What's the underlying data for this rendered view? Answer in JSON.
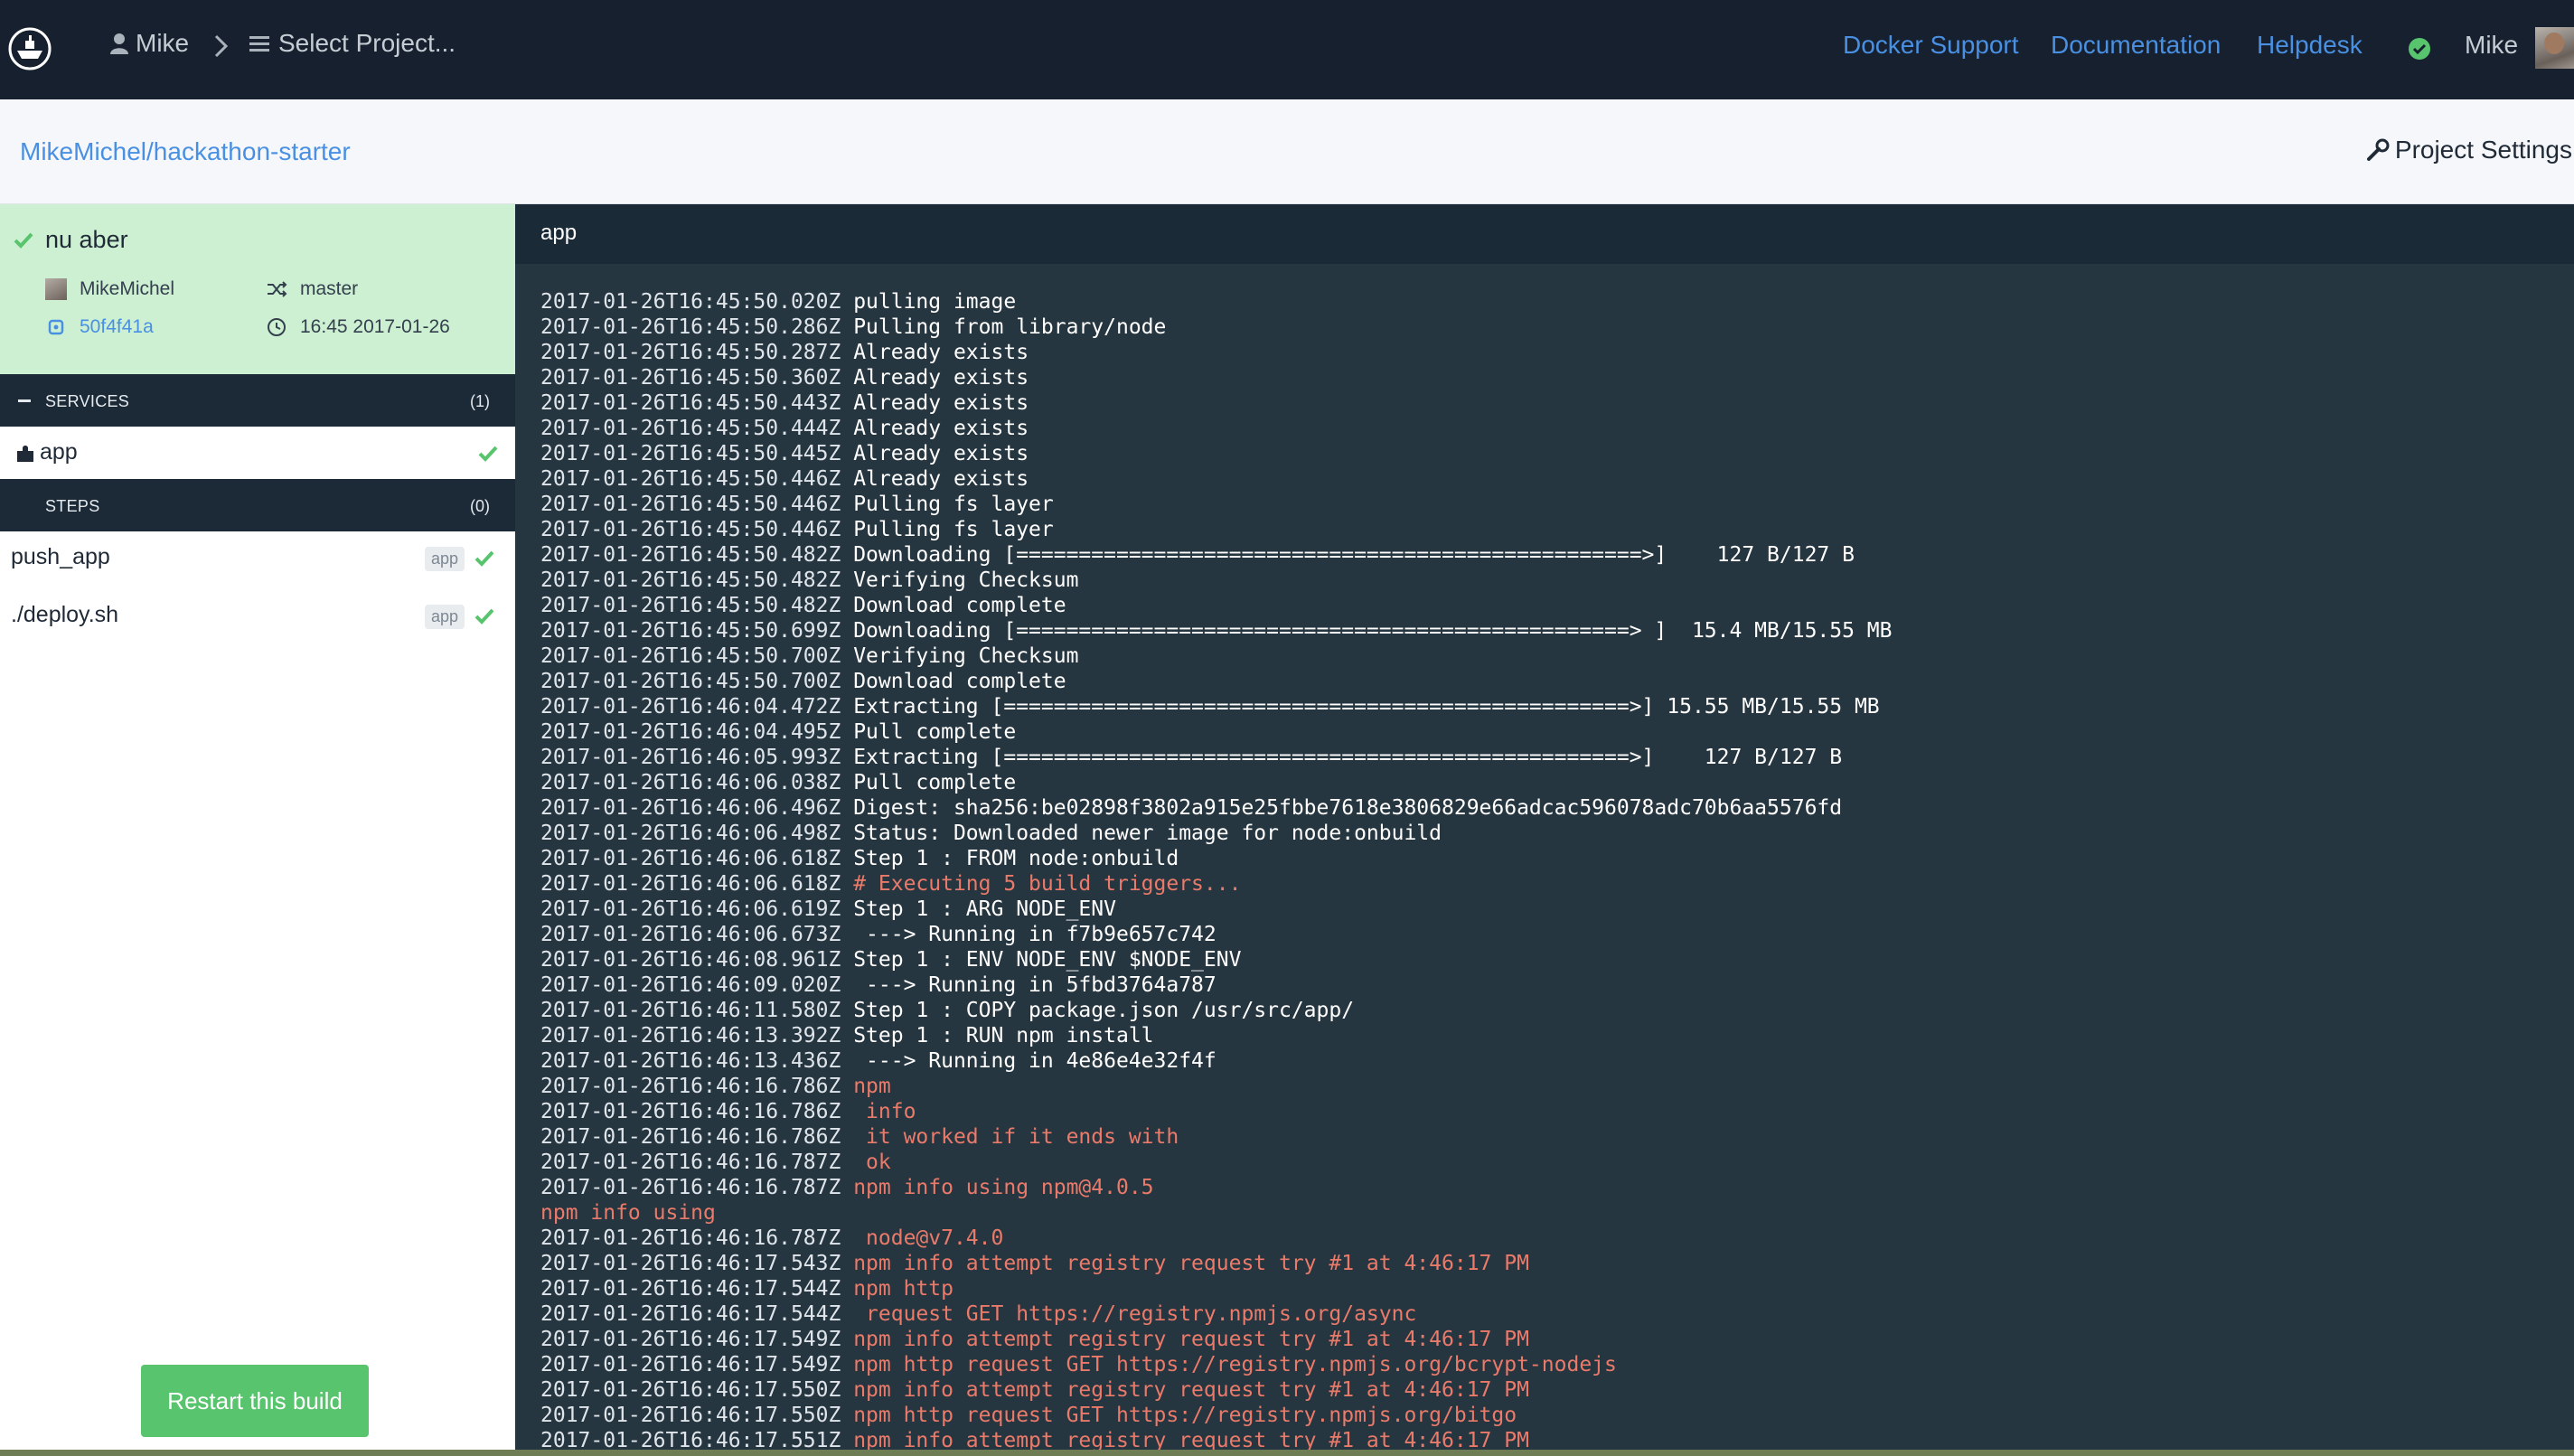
{
  "topbar": {
    "user": "Mike",
    "project_select": "Select Project...",
    "links": [
      "Docker Support",
      "Documentation",
      "Helpdesk"
    ],
    "account_name": "Mike"
  },
  "subheader": {
    "repo": "MikeMichel/hackathon-starter",
    "settings_label": "Project Settings"
  },
  "build": {
    "title": "nu aber",
    "author": "MikeMichel",
    "branch": "master",
    "commit": "50f4f41a",
    "time": "16:45 2017-01-26"
  },
  "services": {
    "label": "SERVICES",
    "count": "(1)",
    "items": [
      {
        "name": "app"
      }
    ]
  },
  "steps": {
    "label": "STEPS",
    "count": "(0)",
    "items": [
      {
        "name": "push_app",
        "tag": "app"
      },
      {
        "name": "./deploy.sh",
        "tag": "app"
      }
    ]
  },
  "restart_label": "Restart this build",
  "log": {
    "title": "app",
    "lines": [
      {
        "ts": "2017-01-26T16:45:50.020Z",
        "msg": "pulling image",
        "err": false
      },
      {
        "ts": "2017-01-26T16:45:50.286Z",
        "msg": "Pulling from library/node",
        "err": false
      },
      {
        "ts": "2017-01-26T16:45:50.287Z",
        "msg": "Already exists",
        "err": false
      },
      {
        "ts": "2017-01-26T16:45:50.360Z",
        "msg": "Already exists",
        "err": false
      },
      {
        "ts": "2017-01-26T16:45:50.443Z",
        "msg": "Already exists",
        "err": false
      },
      {
        "ts": "2017-01-26T16:45:50.444Z",
        "msg": "Already exists",
        "err": false
      },
      {
        "ts": "2017-01-26T16:45:50.445Z",
        "msg": "Already exists",
        "err": false
      },
      {
        "ts": "2017-01-26T16:45:50.446Z",
        "msg": "Already exists",
        "err": false
      },
      {
        "ts": "2017-01-26T16:45:50.446Z",
        "msg": "Pulling fs layer",
        "err": false
      },
      {
        "ts": "2017-01-26T16:45:50.446Z",
        "msg": "Pulling fs layer",
        "err": false
      },
      {
        "ts": "2017-01-26T16:45:50.482Z",
        "msg": "Downloading [==================================================>]    127 B/127 B",
        "err": false
      },
      {
        "ts": "2017-01-26T16:45:50.482Z",
        "msg": "Verifying Checksum",
        "err": false
      },
      {
        "ts": "2017-01-26T16:45:50.482Z",
        "msg": "Download complete",
        "err": false
      },
      {
        "ts": "2017-01-26T16:45:50.699Z",
        "msg": "Downloading [=================================================> ]  15.4 MB/15.55 MB",
        "err": false
      },
      {
        "ts": "2017-01-26T16:45:50.700Z",
        "msg": "Verifying Checksum",
        "err": false
      },
      {
        "ts": "2017-01-26T16:45:50.700Z",
        "msg": "Download complete",
        "err": false
      },
      {
        "ts": "2017-01-26T16:46:04.472Z",
        "msg": "Extracting [==================================================>] 15.55 MB/15.55 MB",
        "err": false
      },
      {
        "ts": "2017-01-26T16:46:04.495Z",
        "msg": "Pull complete",
        "err": false
      },
      {
        "ts": "2017-01-26T16:46:05.993Z",
        "msg": "Extracting [==================================================>]    127 B/127 B",
        "err": false
      },
      {
        "ts": "2017-01-26T16:46:06.038Z",
        "msg": "Pull complete",
        "err": false
      },
      {
        "ts": "2017-01-26T16:46:06.496Z",
        "msg": "Digest: sha256:be02898f3802a915e25fbbe7618e3806829e66adcac596078adc70b6aa5576fd",
        "err": false
      },
      {
        "ts": "2017-01-26T16:46:06.498Z",
        "msg": "Status: Downloaded newer image for node:onbuild",
        "err": false
      },
      {
        "ts": "2017-01-26T16:46:06.618Z",
        "msg": "Step 1 : FROM node:onbuild",
        "err": false
      },
      {
        "ts": "2017-01-26T16:46:06.618Z",
        "msg": "# Executing 5 build triggers...",
        "err": true
      },
      {
        "ts": "2017-01-26T16:46:06.619Z",
        "msg": "Step 1 : ARG NODE_ENV",
        "err": false
      },
      {
        "ts": "2017-01-26T16:46:06.673Z",
        "msg": " ---> Running in f7b9e657c742",
        "err": false
      },
      {
        "ts": "2017-01-26T16:46:08.961Z",
        "msg": "Step 1 : ENV NODE_ENV $NODE_ENV",
        "err": false
      },
      {
        "ts": "2017-01-26T16:46:09.020Z",
        "msg": " ---> Running in 5fbd3764a787",
        "err": false
      },
      {
        "ts": "2017-01-26T16:46:11.580Z",
        "msg": "Step 1 : COPY package.json /usr/src/app/",
        "err": false
      },
      {
        "ts": "2017-01-26T16:46:13.392Z",
        "msg": "Step 1 : RUN npm install",
        "err": false
      },
      {
        "ts": "2017-01-26T16:46:13.436Z",
        "msg": " ---> Running in 4e86e4e32f4f",
        "err": false
      },
      {
        "ts": "2017-01-26T16:46:16.786Z",
        "msg": "npm",
        "err": true
      },
      {
        "ts": "2017-01-26T16:46:16.786Z",
        "msg": " info",
        "err": true
      },
      {
        "ts": "2017-01-26T16:46:16.786Z",
        "msg": " it worked if it ends with",
        "err": true
      },
      {
        "ts": "2017-01-26T16:46:16.787Z",
        "msg": " ok",
        "err": true
      },
      {
        "ts": "2017-01-26T16:46:16.787Z",
        "msg": "npm info using npm@4.0.5",
        "err": true
      },
      {
        "ts": "",
        "msg": "npm info using",
        "err": true
      },
      {
        "ts": "2017-01-26T16:46:16.787Z",
        "msg": " node@v7.4.0",
        "err": true
      },
      {
        "ts": "2017-01-26T16:46:17.543Z",
        "msg": "npm info attempt registry request try #1 at 4:46:17 PM",
        "err": true
      },
      {
        "ts": "2017-01-26T16:46:17.544Z",
        "msg": "npm http",
        "err": true
      },
      {
        "ts": "2017-01-26T16:46:17.544Z",
        "msg": " request GET https://registry.npmjs.org/async",
        "err": true
      },
      {
        "ts": "2017-01-26T16:46:17.549Z",
        "msg": "npm info attempt registry request try #1 at 4:46:17 PM",
        "err": true
      },
      {
        "ts": "2017-01-26T16:46:17.549Z",
        "msg": "npm http request GET https://registry.npmjs.org/bcrypt-nodejs",
        "err": true
      },
      {
        "ts": "2017-01-26T16:46:17.550Z",
        "msg": "npm info attempt registry request try #1 at 4:46:17 PM",
        "err": true
      },
      {
        "ts": "2017-01-26T16:46:17.550Z",
        "msg": "npm http request GET https://registry.npmjs.org/bitgo",
        "err": true
      },
      {
        "ts": "2017-01-26T16:46:17.551Z",
        "msg": "npm info attempt registry request try #1 at 4:46:17 PM",
        "err": true
      }
    ]
  },
  "colors": {
    "navbar": "#16202e",
    "link": "#4a90e2",
    "success": "#58c46d",
    "log_bg": "#263640",
    "log_error": "#ea7a6a"
  }
}
